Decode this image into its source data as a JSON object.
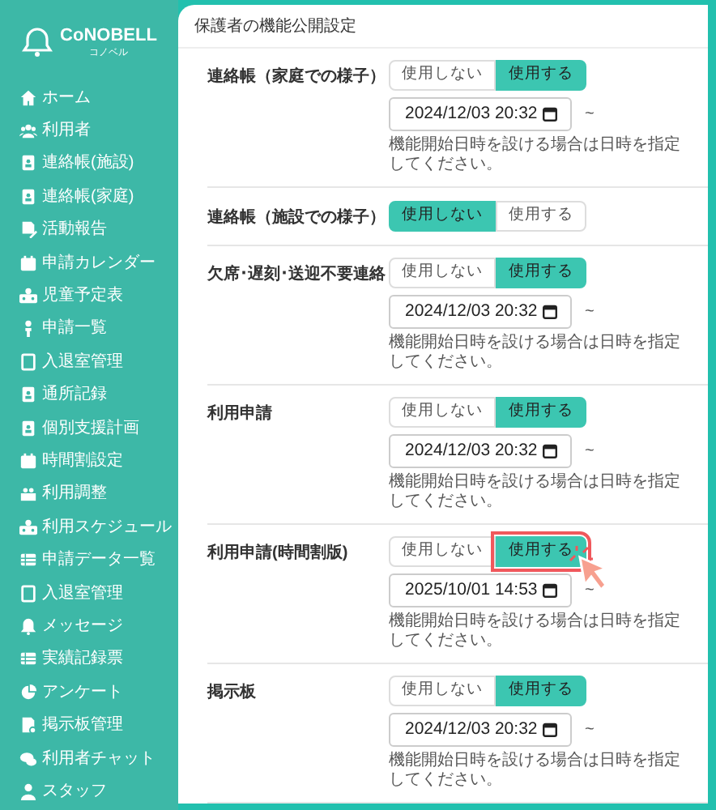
{
  "logo": {
    "name": "CoNOBELL",
    "sub": "コノベル"
  },
  "sidebar": {
    "items": [
      {
        "label": "ホーム"
      },
      {
        "label": "利用者"
      },
      {
        "label": "連絡帳(施設)"
      },
      {
        "label": "連絡帳(家庭)"
      },
      {
        "label": "活動報告"
      },
      {
        "label": "申請カレンダー"
      },
      {
        "label": "児童予定表"
      },
      {
        "label": "申請一覧"
      },
      {
        "label": "入退室管理"
      },
      {
        "label": "通所記録"
      },
      {
        "label": "個別支援計画"
      },
      {
        "label": "時間割設定"
      },
      {
        "label": "利用調整"
      },
      {
        "label": "利用スケジュール"
      },
      {
        "label": "申請データ一覧"
      },
      {
        "label": "入退室管理"
      },
      {
        "label": "メッセージ"
      },
      {
        "label": "実績記録票"
      },
      {
        "label": "アンケート"
      },
      {
        "label": "掲示板管理"
      },
      {
        "label": "利用者チャット"
      },
      {
        "label": "スタッフ"
      }
    ]
  },
  "page_title": "保護者の機能公開設定",
  "settings": [
    {
      "label": "連絡帳（家庭での様子）",
      "options": [
        {
          "label": "使用しない",
          "selected": false
        },
        {
          "label": "使用する",
          "selected": true
        }
      ],
      "start": {
        "value": "2024/12/03 20:32",
        "suffix": "~"
      },
      "hint": "機能開始日時を設ける場合は日時を指定してください。",
      "highlighted": false
    },
    {
      "label": "連絡帳（施設での様子）",
      "options": [
        {
          "label": "使用しない",
          "selected": true
        },
        {
          "label": "使用する",
          "selected": false
        }
      ],
      "highlighted": false
    },
    {
      "label": "欠席･遅刻･送迎不要連絡",
      "options": [
        {
          "label": "使用しない",
          "selected": false
        },
        {
          "label": "使用する",
          "selected": true
        }
      ],
      "start": {
        "value": "2024/12/03 20:32",
        "suffix": "~"
      },
      "hint": "機能開始日時を設ける場合は日時を指定してください。",
      "highlighted": false
    },
    {
      "label": "利用申請",
      "options": [
        {
          "label": "使用しない",
          "selected": false
        },
        {
          "label": "使用する",
          "selected": true
        }
      ],
      "start": {
        "value": "2024/12/03 20:32",
        "suffix": "~"
      },
      "hint": "機能開始日時を設ける場合は日時を指定してください。",
      "highlighted": false
    },
    {
      "label": "利用申請(時間割版)",
      "options": [
        {
          "label": "使用しない",
          "selected": false
        },
        {
          "label": "使用する",
          "selected": true
        }
      ],
      "start": {
        "value": "2025/10/01 14:53",
        "suffix": "~"
      },
      "hint": "機能開始日時を設ける場合は日時を指定してください。",
      "highlighted": true
    },
    {
      "label": "掲示板",
      "options": [
        {
          "label": "使用しない",
          "selected": false
        },
        {
          "label": "使用する",
          "selected": true
        }
      ],
      "start": {
        "value": "2024/12/03 20:32",
        "suffix": "~"
      },
      "hint": "機能開始日時を設ける場合は日時を指定してください。",
      "highlighted": false
    }
  ]
}
